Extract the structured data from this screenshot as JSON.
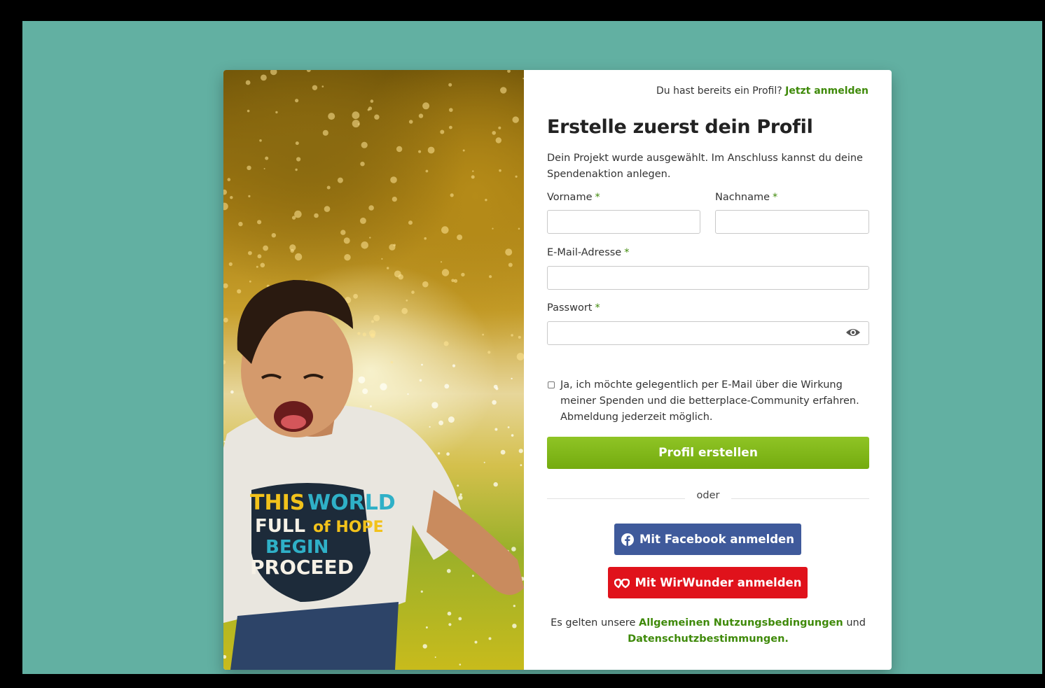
{
  "header": {
    "already_have_profile": "Du hast bereits ein Profil?",
    "login_link": "Jetzt anmelden"
  },
  "form": {
    "title": "Erstelle zuerst dein Profil",
    "subtitle": "Dein Projekt wurde ausgewählt. Im Anschluss kannst du deine Spendenaktion anlegen.",
    "required_marker": "*",
    "first_name": {
      "label": "Vorname",
      "value": ""
    },
    "last_name": {
      "label": "Nachname",
      "value": ""
    },
    "email": {
      "label": "E-Mail-Adresse",
      "value": ""
    },
    "password": {
      "label": "Passwort",
      "value": ""
    },
    "newsletter": {
      "checked": false,
      "text": "Ja, ich möchte gelegentlich per E-Mail über die Wirkung meiner Spenden und die betterplace-Community erfahren. Abmeldung jederzeit möglich."
    },
    "submit_label": "Profil erstellen",
    "divider": "oder",
    "facebook_label": "Mit Facebook anmelden",
    "wirwunder_label": "Mit WirWunder anmelden",
    "legal": {
      "prefix": "Es gelten unsere",
      "terms_link": "Allgemeinen Nutzungsbedingungen",
      "conjunction": "und",
      "privacy_link": "Datenschutzbestimmungen."
    }
  },
  "colors": {
    "background": "#62b0a2",
    "accent_green": "#3f8a0a",
    "primary_button": "#7cb518",
    "facebook": "#3f5a9b",
    "wirwunder": "#e0121b"
  },
  "icons": {
    "password_toggle": "eye-icon",
    "facebook": "facebook-icon",
    "wirwunder": "wirwunder-heart-icon"
  }
}
